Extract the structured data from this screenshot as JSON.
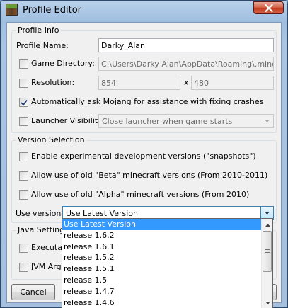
{
  "window": {
    "title": "Profile Editor",
    "close_icon": "close-icon"
  },
  "profile_info": {
    "group_title": "Profile Info",
    "profile_name_label": "Profile Name:",
    "profile_name_value": "Darky_Alan",
    "game_directory_label": "Game Directory:",
    "game_directory_checked": false,
    "game_directory_value": "C:\\Users\\Darky Alan\\AppData\\Roaming\\.minecraft",
    "resolution_label": "Resolution:",
    "resolution_checked": false,
    "resolution_width": "854",
    "resolution_separator": "x",
    "resolution_height": "480",
    "auto_crash_label": "Automatically ask Mojang for assistance with fixing crashes",
    "auto_crash_checked": true,
    "launcher_visibility_label": "Launcher Visibility:",
    "launcher_visibility_checked": false,
    "launcher_visibility_value": "Close launcher when game starts"
  },
  "version_selection": {
    "group_title": "Version Selection",
    "snapshots_label": "Enable experimental development versions (\"snapshots\")",
    "beta_label": "Allow use of old \"Beta\" minecraft versions (From 2010-2011)",
    "alpha_label": "Allow use of old \"Alpha\" minecraft versions (From 2010)",
    "use_version_label": "Use version:",
    "use_version_value": "Use Latest Version",
    "dropdown_options": [
      "Use Latest Version",
      "release 1.6.2",
      "release 1.6.1",
      "release 1.5.2",
      "release 1.5.1",
      "release 1.5",
      "release 1.4.7",
      "release 1.4.6"
    ],
    "selected_index": 0
  },
  "java_settings": {
    "group_title": "Java Settings",
    "executable_label": "Executab",
    "jvm_args_label": "JVM Argu"
  },
  "buttons": {
    "cancel_label": "Cancel"
  },
  "colors": {
    "selection": "#3399ff",
    "window_frame": "#a9c5e3",
    "close_button": "#c23b1f"
  }
}
